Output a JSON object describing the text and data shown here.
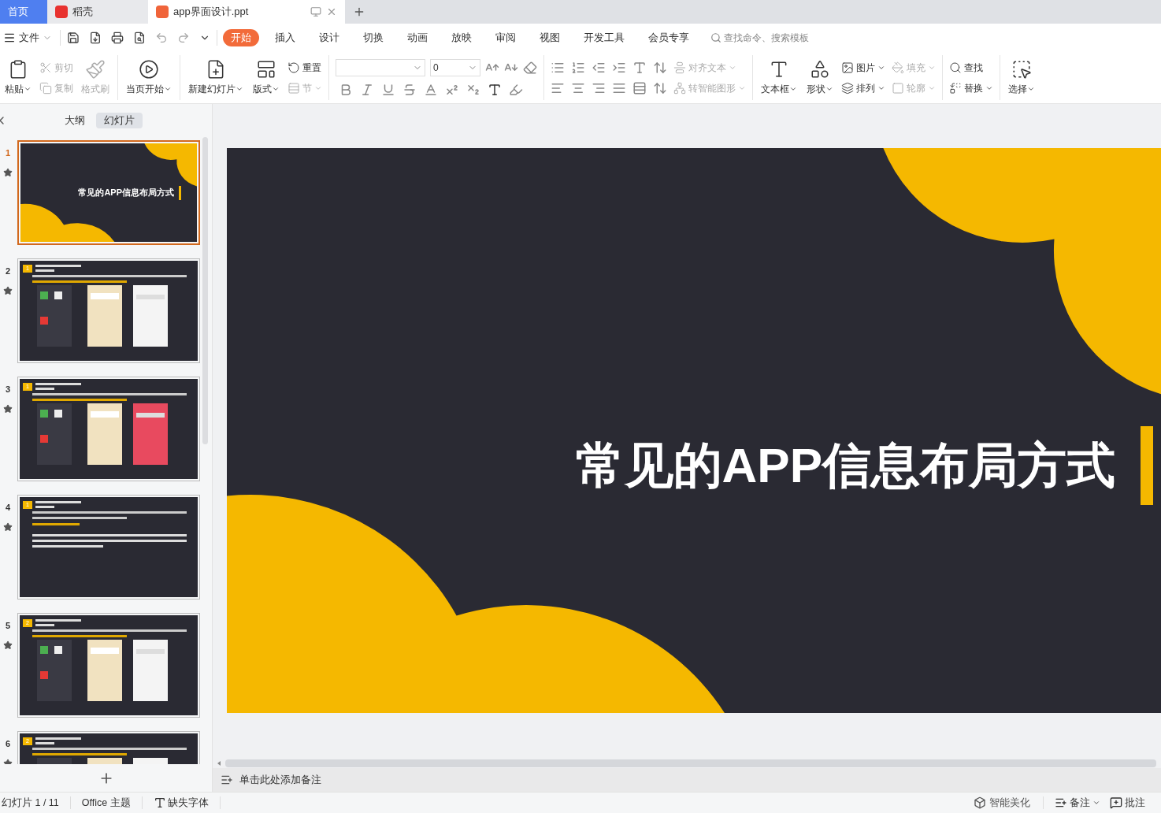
{
  "doc_tabs": [
    {
      "label": "首页",
      "kind": "home",
      "selected": false
    },
    {
      "label": "稻壳",
      "kind": "docer",
      "selected": false
    },
    {
      "label": "app界面设计.ppt",
      "kind": "doc",
      "selected": true
    }
  ],
  "menu": {
    "file": "文件",
    "ribbon_tabs": [
      {
        "label": "开始",
        "selected": true
      },
      {
        "label": "插入",
        "selected": false
      },
      {
        "label": "设计",
        "selected": false
      },
      {
        "label": "切换",
        "selected": false
      },
      {
        "label": "动画",
        "selected": false
      },
      {
        "label": "放映",
        "selected": false
      },
      {
        "label": "审阅",
        "selected": false
      },
      {
        "label": "视图",
        "selected": false
      },
      {
        "label": "开发工具",
        "selected": false
      },
      {
        "label": "会员专享",
        "selected": false
      }
    ],
    "search": {
      "placeholder": "查找命令、搜索模板"
    }
  },
  "ribbon": [
    {
      "kind": "large",
      "label": "粘贴",
      "dropdown": true,
      "disabled": false
    },
    {
      "kind": "stack",
      "items": [
        {
          "label": "剪切",
          "dropdown": false,
          "disabled": true
        },
        {
          "label": "复制",
          "dropdown": false,
          "disabled": true
        }
      ]
    },
    {
      "kind": "large",
      "label": "格式刷",
      "dropdown": false,
      "disabled": true
    },
    {
      "kind": "sep"
    },
    {
      "kind": "large",
      "label": "当页开始",
      "dropdown": true,
      "disabled": false
    },
    {
      "kind": "sep"
    },
    {
      "kind": "large",
      "label": "新建幻灯片",
      "dropdown": true,
      "disabled": false
    },
    {
      "kind": "large",
      "label": "版式",
      "dropdown": true,
      "disabled": false
    },
    {
      "kind": "stack",
      "items": [
        {
          "label": "重置",
          "dropdown": false,
          "disabled": false
        },
        {
          "label": "节",
          "dropdown": true,
          "disabled": true
        }
      ]
    },
    {
      "kind": "sep"
    },
    {
      "kind": "font",
      "size": "0"
    },
    {
      "kind": "sep"
    },
    {
      "kind": "para"
    },
    {
      "kind": "stack",
      "items": [
        {
          "label": "对齐文本",
          "dropdown": true,
          "disabled": true
        },
        {
          "label": "转智能图形",
          "dropdown": true,
          "disabled": true
        }
      ]
    },
    {
      "kind": "sep"
    },
    {
      "kind": "large",
      "label": "文本框",
      "dropdown": true,
      "disabled": false
    },
    {
      "kind": "large",
      "label": "形状",
      "dropdown": true,
      "disabled": false
    },
    {
      "kind": "stack",
      "items": [
        {
          "label": "图片",
          "dropdown": true,
          "disabled": false
        },
        {
          "label": "排列",
          "dropdown": true,
          "disabled": false
        }
      ]
    },
    {
      "kind": "stack",
      "items": [
        {
          "label": "填充",
          "dropdown": true,
          "disabled": true
        },
        {
          "label": "轮廓",
          "dropdown": true,
          "disabled": true
        }
      ]
    },
    {
      "kind": "sep"
    },
    {
      "kind": "stack",
      "items": [
        {
          "label": "查找",
          "dropdown": false,
          "disabled": false
        },
        {
          "label": "替换",
          "dropdown": true,
          "disabled": false
        }
      ]
    },
    {
      "kind": "sep"
    },
    {
      "kind": "large",
      "label": "选择",
      "dropdown": true,
      "disabled": false
    }
  ],
  "side_panel": {
    "views": [
      {
        "label": "大纲",
        "selected": false
      },
      {
        "label": "幻灯片",
        "selected": true
      }
    ],
    "slides": [
      {
        "number": "1",
        "selected": true,
        "kind": "title",
        "title": "常见的APP信息布局方式"
      },
      {
        "number": "2",
        "selected": false,
        "kind": "content",
        "badge": "1"
      },
      {
        "number": "3",
        "selected": false,
        "kind": "content",
        "badge": "1"
      },
      {
        "number": "4",
        "selected": false,
        "kind": "text",
        "badge": "1"
      },
      {
        "number": "5",
        "selected": false,
        "kind": "content",
        "badge": "2"
      },
      {
        "number": "6",
        "selected": false,
        "kind": "content",
        "badge": "2"
      }
    ]
  },
  "slide": {
    "title": "常见的APP信息布局方式"
  },
  "notes": {
    "placeholder": "单击此处添加备注"
  },
  "status_bar": {
    "left": [
      "幻灯片 1 / 11",
      "Office 主题"
    ],
    "missing_fonts": "缺失字体",
    "beautify": "智能美化",
    "notes": "备注",
    "comments": "批注"
  }
}
